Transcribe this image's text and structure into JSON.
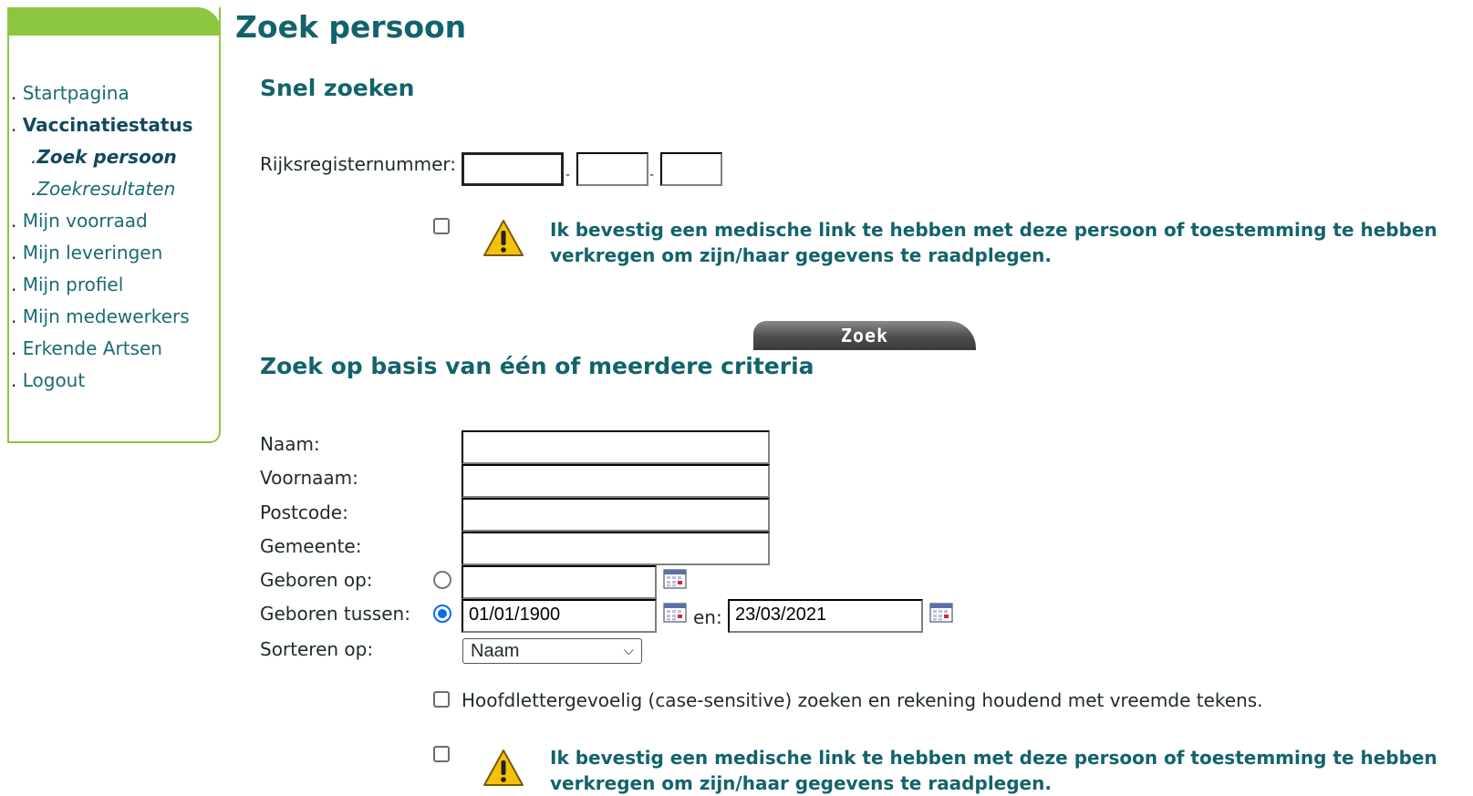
{
  "page_title": "Zoek persoon",
  "sidebar": {
    "items": [
      {
        "label": "Startpagina"
      },
      {
        "label": "Vaccinatiestatus"
      },
      {
        "label": "Zoek persoon"
      },
      {
        "label": "Zoekresultaten"
      },
      {
        "label": "Mijn voorraad"
      },
      {
        "label": "Mijn leveringen"
      },
      {
        "label": "Mijn profiel"
      },
      {
        "label": "Mijn medewerkers"
      },
      {
        "label": "Erkende Artsen"
      },
      {
        "label": "Logout"
      }
    ]
  },
  "quick_search": {
    "heading": "Snel zoeken",
    "rrn_label": "Rijksregisternummer:",
    "rrn_part1": "",
    "rrn_part2": "",
    "rrn_part3": "",
    "separator": "-",
    "consent_text": "Ik bevestig een medische link te hebben met deze persoon of toestemming te hebben verkregen om zijn/haar gegevens te raadplegen.",
    "search_button": "Zoek"
  },
  "criteria_search": {
    "heading": "Zoek op basis van één of meerdere criteria",
    "name_label": "Naam:",
    "firstname_label": "Voornaam:",
    "postcode_label": "Postcode:",
    "municipality_label": "Gemeente:",
    "born_on_label": "Geboren op:",
    "born_between_label": "Geboren tussen:",
    "born_between_from": "01/01/1900",
    "and_label": "en:",
    "born_between_to": "23/03/2021",
    "sort_label": "Sorteren op:",
    "sort_value": "Naam",
    "case_sensitive_text": "Hoofdlettergevoelig (case-sensitive) zoeken en rekening houdend met vreemde tekens.",
    "consent_text": "Ik bevestig een medische link te hebben met deze persoon of toestemming te hebben verkregen om zijn/haar gegevens te raadplegen."
  },
  "colors": {
    "accent_green": "#8dc63f",
    "heading_teal": "#13636b",
    "radio_blue": "#0b6bea"
  }
}
